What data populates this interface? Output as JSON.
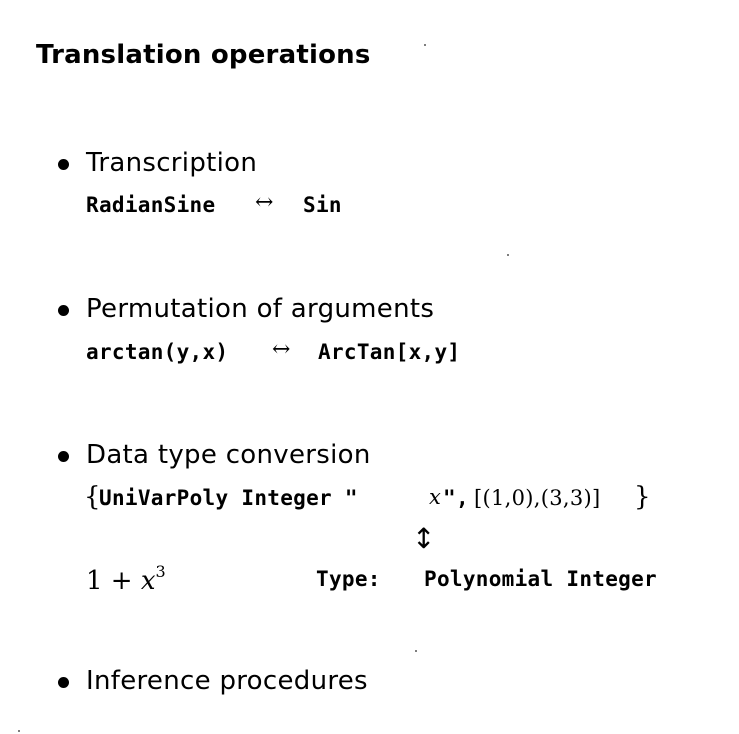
{
  "title": "Translation operations",
  "items": [
    {
      "heading": "Transcription",
      "left": "RadianSine",
      "arrow": "↔",
      "right": "Sin"
    },
    {
      "heading": "Permutation of arguments",
      "left": "arctan(y,x)",
      "arrow": "↔",
      "right": "ArcTan[x,y]"
    },
    {
      "heading": "Data type conversion",
      "brace_open": "{",
      "code": "UniVarPoly Integer \"",
      "var": "x",
      "code_end": "\",",
      "list": "[(1,0),(3,3)]",
      "brace_close": "}",
      "vertical_arrow": "↕",
      "expr_lead": "1 + ",
      "expr_var": "x",
      "expr_exp": "3",
      "type_label": "Type:",
      "type_value": "Polynomial Integer"
    },
    {
      "heading": "Inference procedures"
    }
  ]
}
